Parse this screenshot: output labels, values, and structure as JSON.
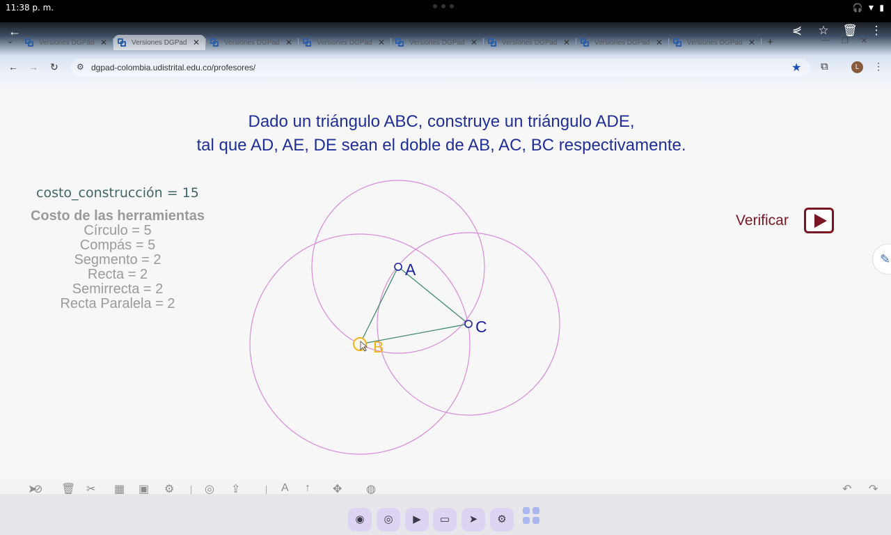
{
  "status_bar": {
    "time": "11:38 p. m."
  },
  "browser": {
    "tabs": [
      {
        "label": "Versiones DGPad",
        "active": false
      },
      {
        "label": "Versiones DGPad",
        "active": true
      },
      {
        "label": "Versiones DGPad",
        "active": false
      },
      {
        "label": "Versiones DGPad",
        "active": false
      },
      {
        "label": "Versiones DGPad",
        "active": false
      },
      {
        "label": "Versiones DGPad",
        "active": false
      },
      {
        "label": "Versiones DGPad",
        "active": false
      },
      {
        "label": "Versiones DGPad",
        "active": false
      }
    ],
    "url": "dgpad-colombia.udistrital.edu.co/profesores/",
    "profile_initial": "L"
  },
  "page": {
    "title_line1": "Dado un triángulo ABC, construye un triángulo ADE,",
    "title_line2": "tal que AD, AE, DE sean el doble de AB, AC, BC respectivamente.",
    "cost_total": "costo_construcción = 15",
    "tools_title": "Costo de las herramientas",
    "tools": [
      "Círculo = 5",
      "Compás = 5",
      "Segmento = 2",
      "Recta = 2",
      "Semirrecta = 2",
      "Recta Paralela = 2"
    ],
    "verify_label": "Verificar"
  },
  "construction": {
    "points": [
      {
        "label": "A",
        "color": "#1a1fa0"
      },
      {
        "label": "B",
        "color": "#f2b21b"
      },
      {
        "label": "C",
        "color": "#1a1fa0"
      }
    ],
    "segment_color": "#3f8a6a",
    "circle_color": "#d98ad9"
  }
}
